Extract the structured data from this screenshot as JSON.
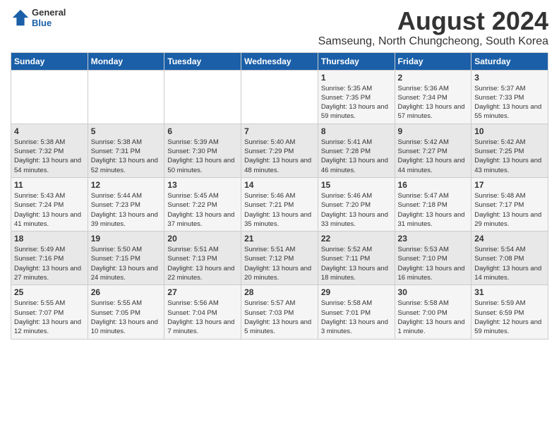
{
  "logo": {
    "general": "General",
    "blue": "Blue"
  },
  "title": "August 2024",
  "location": "Samseung, North Chungcheong, South Korea",
  "weekdays": [
    "Sunday",
    "Monday",
    "Tuesday",
    "Wednesday",
    "Thursday",
    "Friday",
    "Saturday"
  ],
  "weeks": [
    [
      {
        "day": "",
        "info": ""
      },
      {
        "day": "",
        "info": ""
      },
      {
        "day": "",
        "info": ""
      },
      {
        "day": "",
        "info": ""
      },
      {
        "day": "1",
        "sunrise": "Sunrise: 5:35 AM",
        "sunset": "Sunset: 7:35 PM",
        "daylight": "Daylight: 13 hours and 59 minutes."
      },
      {
        "day": "2",
        "sunrise": "Sunrise: 5:36 AM",
        "sunset": "Sunset: 7:34 PM",
        "daylight": "Daylight: 13 hours and 57 minutes."
      },
      {
        "day": "3",
        "sunrise": "Sunrise: 5:37 AM",
        "sunset": "Sunset: 7:33 PM",
        "daylight": "Daylight: 13 hours and 55 minutes."
      }
    ],
    [
      {
        "day": "4",
        "sunrise": "Sunrise: 5:38 AM",
        "sunset": "Sunset: 7:32 PM",
        "daylight": "Daylight: 13 hours and 54 minutes."
      },
      {
        "day": "5",
        "sunrise": "Sunrise: 5:38 AM",
        "sunset": "Sunset: 7:31 PM",
        "daylight": "Daylight: 13 hours and 52 minutes."
      },
      {
        "day": "6",
        "sunrise": "Sunrise: 5:39 AM",
        "sunset": "Sunset: 7:30 PM",
        "daylight": "Daylight: 13 hours and 50 minutes."
      },
      {
        "day": "7",
        "sunrise": "Sunrise: 5:40 AM",
        "sunset": "Sunset: 7:29 PM",
        "daylight": "Daylight: 13 hours and 48 minutes."
      },
      {
        "day": "8",
        "sunrise": "Sunrise: 5:41 AM",
        "sunset": "Sunset: 7:28 PM",
        "daylight": "Daylight: 13 hours and 46 minutes."
      },
      {
        "day": "9",
        "sunrise": "Sunrise: 5:42 AM",
        "sunset": "Sunset: 7:27 PM",
        "daylight": "Daylight: 13 hours and 44 minutes."
      },
      {
        "day": "10",
        "sunrise": "Sunrise: 5:42 AM",
        "sunset": "Sunset: 7:25 PM",
        "daylight": "Daylight: 13 hours and 43 minutes."
      }
    ],
    [
      {
        "day": "11",
        "sunrise": "Sunrise: 5:43 AM",
        "sunset": "Sunset: 7:24 PM",
        "daylight": "Daylight: 13 hours and 41 minutes."
      },
      {
        "day": "12",
        "sunrise": "Sunrise: 5:44 AM",
        "sunset": "Sunset: 7:23 PM",
        "daylight": "Daylight: 13 hours and 39 minutes."
      },
      {
        "day": "13",
        "sunrise": "Sunrise: 5:45 AM",
        "sunset": "Sunset: 7:22 PM",
        "daylight": "Daylight: 13 hours and 37 minutes."
      },
      {
        "day": "14",
        "sunrise": "Sunrise: 5:46 AM",
        "sunset": "Sunset: 7:21 PM",
        "daylight": "Daylight: 13 hours and 35 minutes."
      },
      {
        "day": "15",
        "sunrise": "Sunrise: 5:46 AM",
        "sunset": "Sunset: 7:20 PM",
        "daylight": "Daylight: 13 hours and 33 minutes."
      },
      {
        "day": "16",
        "sunrise": "Sunrise: 5:47 AM",
        "sunset": "Sunset: 7:18 PM",
        "daylight": "Daylight: 13 hours and 31 minutes."
      },
      {
        "day": "17",
        "sunrise": "Sunrise: 5:48 AM",
        "sunset": "Sunset: 7:17 PM",
        "daylight": "Daylight: 13 hours and 29 minutes."
      }
    ],
    [
      {
        "day": "18",
        "sunrise": "Sunrise: 5:49 AM",
        "sunset": "Sunset: 7:16 PM",
        "daylight": "Daylight: 13 hours and 27 minutes."
      },
      {
        "day": "19",
        "sunrise": "Sunrise: 5:50 AM",
        "sunset": "Sunset: 7:15 PM",
        "daylight": "Daylight: 13 hours and 24 minutes."
      },
      {
        "day": "20",
        "sunrise": "Sunrise: 5:51 AM",
        "sunset": "Sunset: 7:13 PM",
        "daylight": "Daylight: 13 hours and 22 minutes."
      },
      {
        "day": "21",
        "sunrise": "Sunrise: 5:51 AM",
        "sunset": "Sunset: 7:12 PM",
        "daylight": "Daylight: 13 hours and 20 minutes."
      },
      {
        "day": "22",
        "sunrise": "Sunrise: 5:52 AM",
        "sunset": "Sunset: 7:11 PM",
        "daylight": "Daylight: 13 hours and 18 minutes."
      },
      {
        "day": "23",
        "sunrise": "Sunrise: 5:53 AM",
        "sunset": "Sunset: 7:10 PM",
        "daylight": "Daylight: 13 hours and 16 minutes."
      },
      {
        "day": "24",
        "sunrise": "Sunrise: 5:54 AM",
        "sunset": "Sunset: 7:08 PM",
        "daylight": "Daylight: 13 hours and 14 minutes."
      }
    ],
    [
      {
        "day": "25",
        "sunrise": "Sunrise: 5:55 AM",
        "sunset": "Sunset: 7:07 PM",
        "daylight": "Daylight: 13 hours and 12 minutes."
      },
      {
        "day": "26",
        "sunrise": "Sunrise: 5:55 AM",
        "sunset": "Sunset: 7:05 PM",
        "daylight": "Daylight: 13 hours and 10 minutes."
      },
      {
        "day": "27",
        "sunrise": "Sunrise: 5:56 AM",
        "sunset": "Sunset: 7:04 PM",
        "daylight": "Daylight: 13 hours and 7 minutes."
      },
      {
        "day": "28",
        "sunrise": "Sunrise: 5:57 AM",
        "sunset": "Sunset: 7:03 PM",
        "daylight": "Daylight: 13 hours and 5 minutes."
      },
      {
        "day": "29",
        "sunrise": "Sunrise: 5:58 AM",
        "sunset": "Sunset: 7:01 PM",
        "daylight": "Daylight: 13 hours and 3 minutes."
      },
      {
        "day": "30",
        "sunrise": "Sunrise: 5:58 AM",
        "sunset": "Sunset: 7:00 PM",
        "daylight": "Daylight: 13 hours and 1 minute."
      },
      {
        "day": "31",
        "sunrise": "Sunrise: 5:59 AM",
        "sunset": "Sunset: 6:59 PM",
        "daylight": "Daylight: 12 hours and 59 minutes."
      }
    ]
  ]
}
